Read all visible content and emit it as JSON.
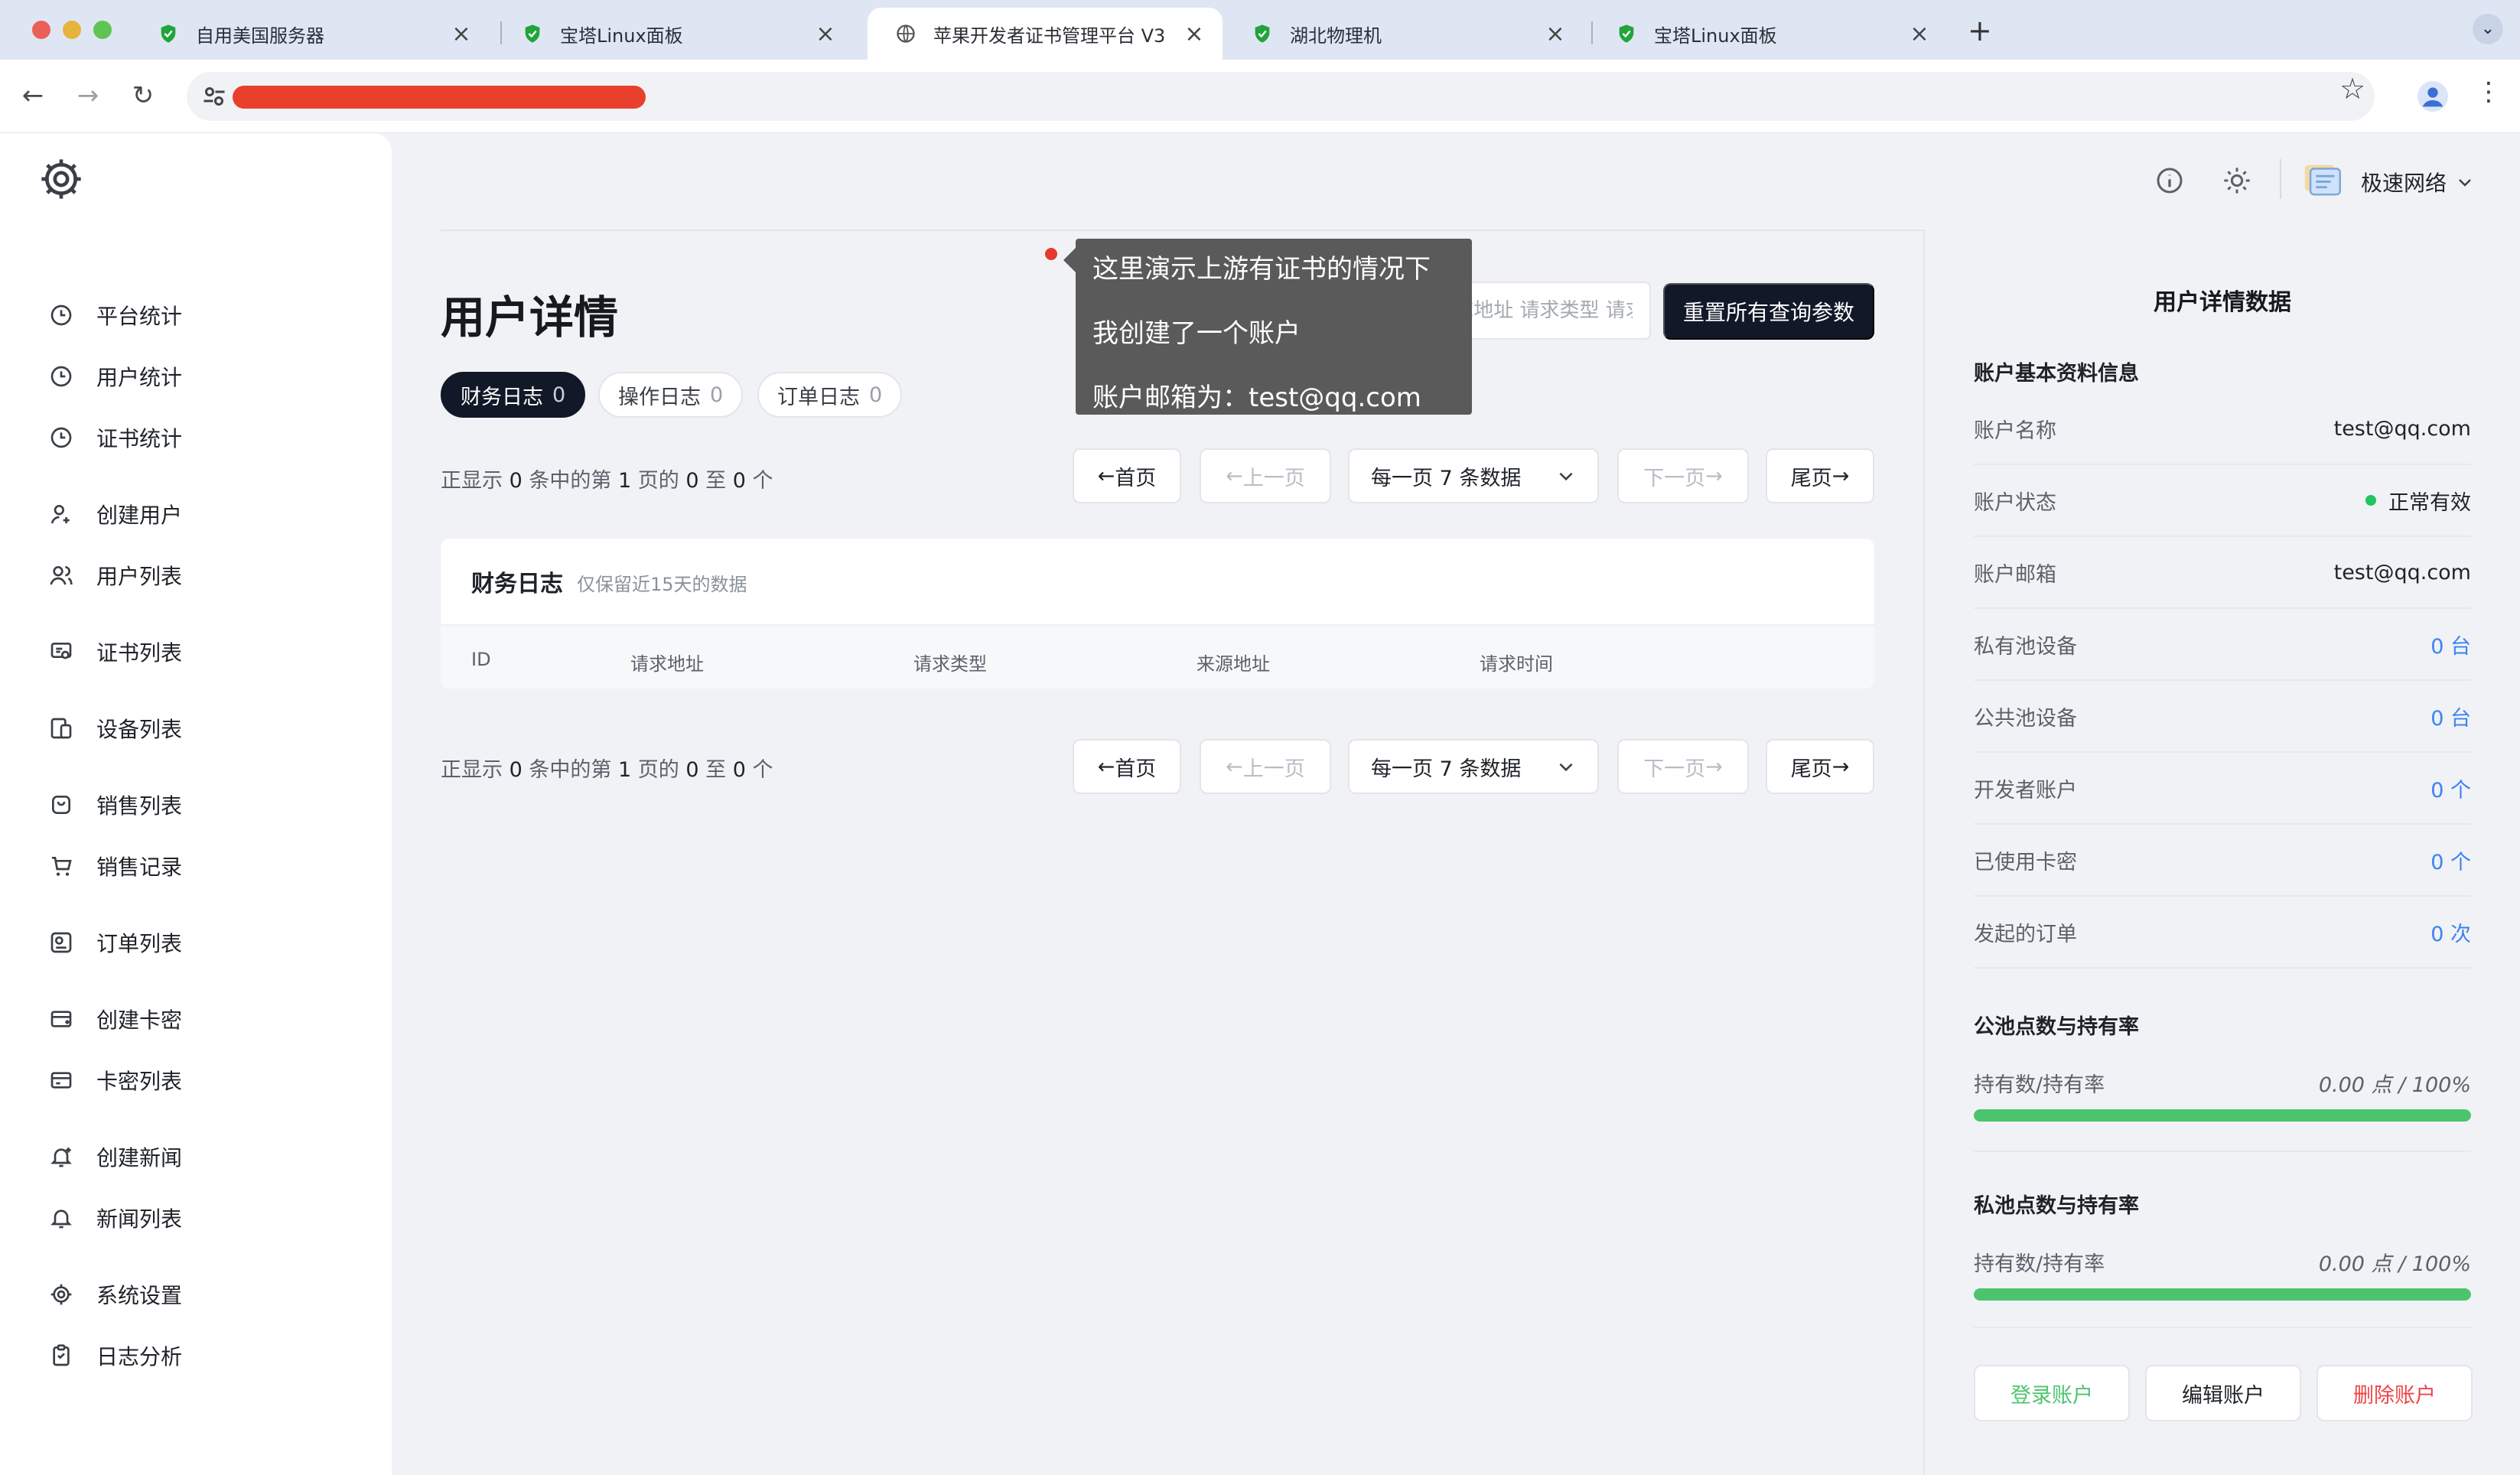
{
  "browser": {
    "tabs": [
      {
        "title": "自用美国服务器",
        "active": false,
        "favicon": "bt-shield-icon"
      },
      {
        "title": "宝塔Linux面板",
        "active": false,
        "favicon": "bt-shield-icon"
      },
      {
        "title": "苹果开发者证书管理平台 V3",
        "active": true,
        "favicon": "globe-icon"
      },
      {
        "title": "湖北物理机",
        "active": false,
        "favicon": "bt-shield-icon"
      },
      {
        "title": "宝塔Linux面板",
        "active": false,
        "favicon": "bt-shield-icon"
      }
    ],
    "new_tab": "+",
    "close_glyph": "×"
  },
  "sidebar": {
    "items": [
      {
        "label": "平台统计",
        "icon": "clock-icon"
      },
      {
        "label": "用户统计",
        "icon": "clock-icon"
      },
      {
        "label": "证书统计",
        "icon": "clock-icon"
      },
      {
        "label": "创建用户",
        "icon": "user-plus-icon"
      },
      {
        "label": "用户列表",
        "icon": "users-icon"
      },
      {
        "label": "证书列表",
        "icon": "certificate-icon"
      },
      {
        "label": "设备列表",
        "icon": "device-icon"
      },
      {
        "label": "销售列表",
        "icon": "sales-icon"
      },
      {
        "label": "销售记录",
        "icon": "cart-icon"
      },
      {
        "label": "订单列表",
        "icon": "order-icon"
      },
      {
        "label": "创建卡密",
        "icon": "card-plus-icon"
      },
      {
        "label": "卡密列表",
        "icon": "card-icon"
      },
      {
        "label": "创建新闻",
        "icon": "bell-plus-icon"
      },
      {
        "label": "新闻列表",
        "icon": "bell-icon"
      },
      {
        "label": "系统设置",
        "icon": "gear-icon"
      },
      {
        "label": "日志分析",
        "icon": "clipboard-icon"
      }
    ]
  },
  "header": {
    "account_name": "极速网络"
  },
  "page": {
    "title": "用户详情",
    "tooltip": [
      "这里演示上游有证书的情况下",
      "我创建了一个账户",
      "账户邮箱为：test@qq.com"
    ],
    "search_placeholder": "来源 请求地址 请求类型 请求时间",
    "reset_label": "重置所有查询参数",
    "tabs": [
      {
        "label": "财务日志",
        "count": "0",
        "active": true
      },
      {
        "label": "操作日志",
        "count": "0",
        "active": false
      },
      {
        "label": "订单日志",
        "count": "0",
        "active": false
      }
    ],
    "pager": {
      "info": {
        "p1": "正显示",
        "total": "0",
        "p2": "条中的第",
        "page": "1",
        "p3": "页的",
        "from": "0",
        "p4": "至",
        "to": "0",
        "p5": "个"
      },
      "first": "首页",
      "prev": "上一页",
      "per_page": "每一页 7 条数据",
      "next": "下一页",
      "last": "尾页"
    },
    "table": {
      "title": "财务日志",
      "subtitle": "仅保留近15天的数据",
      "columns": [
        "ID",
        "请求地址",
        "请求类型",
        "来源地址",
        "请求时间"
      ]
    }
  },
  "details": {
    "title": "用户详情数据",
    "basic_section": "账户基本资料信息",
    "rows": [
      {
        "key": "账户名称",
        "value": "test@qq.com",
        "style": "plain"
      },
      {
        "key": "账户状态",
        "value": "正常有效",
        "style": "status"
      },
      {
        "key": "账户邮箱",
        "value": "test@qq.com",
        "style": "plain"
      },
      {
        "key": "私有池设备",
        "value": "0 台",
        "style": "link"
      },
      {
        "key": "公共池设备",
        "value": "0 台",
        "style": "link"
      },
      {
        "key": "开发者账户",
        "value": "0 个",
        "style": "link"
      },
      {
        "key": "已使用卡密",
        "value": "0 个",
        "style": "link"
      },
      {
        "key": "发起的订单",
        "value": "0 次",
        "style": "link"
      }
    ],
    "public_pool": {
      "title": "公池点数与持有率",
      "label": "持有数/持有率",
      "value": "0.00 点 / 100%",
      "progress": 1.0
    },
    "private_pool": {
      "title": "私池点数与持有率",
      "label": "持有数/持有率",
      "value": "0.00 点 / 100%",
      "progress": 1.0
    },
    "actions": [
      {
        "label": "登录账户",
        "color": "#4cc46e"
      },
      {
        "label": "编辑账户",
        "color": "#1f2329"
      },
      {
        "label": "删除账户",
        "color": "#ef4444"
      }
    ]
  }
}
